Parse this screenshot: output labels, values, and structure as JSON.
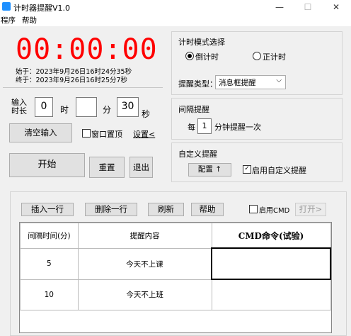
{
  "window": {
    "title": "计时器提醒V1.0",
    "minimize": "—",
    "maximize": "☐",
    "close": "✕"
  },
  "menu": [
    "程序",
    "帮助"
  ],
  "timer": {
    "display": "00:00:00",
    "start_time": "始于：2023年9月26日16时24分35秒",
    "end_time": "终于：2023年9月26日16时25分7秒"
  },
  "input": {
    "label_top": "输入",
    "label_bottom": "时长",
    "hours": "0",
    "hours_unit": "时",
    "minutes": "",
    "minutes_unit": "分",
    "seconds": "30",
    "seconds_unit": "秒"
  },
  "buttons": {
    "clear": "清空输入",
    "always_on_top": "窗口置顶",
    "settings": "设置<",
    "start": "开始",
    "reset": "重置",
    "exit": "退出"
  },
  "mode": {
    "title": "计时模式选择",
    "countdown": "倒计时",
    "countup": "正计时",
    "reminder_type_label": "提醒类型：",
    "reminder_type_value": "消息框提醒"
  },
  "interval": {
    "title": "间隔提醒",
    "prefix": "每",
    "value": "1",
    "suffix": "分钟提醒一次"
  },
  "custom": {
    "title": "自定义提醒",
    "config": "配置 ↑",
    "enable": "启用自定义提醒"
  },
  "table_toolbar": {
    "insert": "插入一行",
    "delete": "删除一行",
    "refresh": "刷新",
    "help": "帮助",
    "enable_cmd": "启用CMD",
    "open": "打开>"
  },
  "table": {
    "headers": [
      "间隔时间(分)",
      "提醒内容",
      "CMD命令(试验)"
    ],
    "rows": [
      [
        "5",
        "今天不上课",
        ""
      ],
      [
        "10",
        "今天不上班",
        ""
      ]
    ]
  }
}
